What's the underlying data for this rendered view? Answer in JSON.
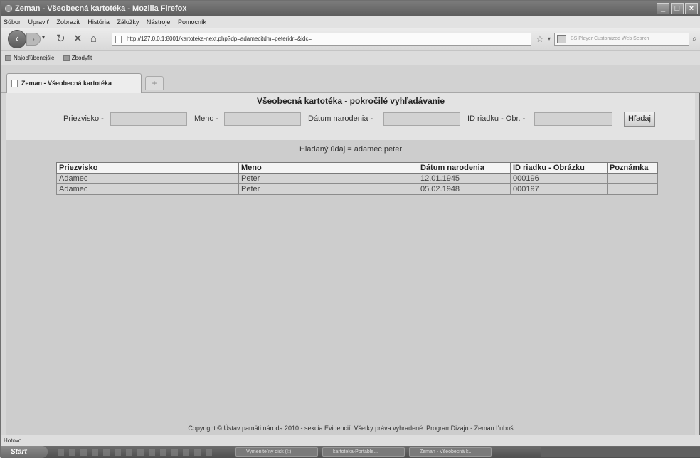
{
  "window": {
    "title": "Zeman - Všeobecná kartotéka - Mozilla Firefox"
  },
  "menu": [
    "Súbor",
    "Upraviť",
    "Zobraziť",
    "História",
    "Záložky",
    "Nástroje",
    "Pomocník"
  ],
  "nav": {
    "url": "http://127.0.0.1:8001/kartoteka-next.php?dp=adamecitdm=peteridr=&idc=",
    "search_placeholder": "BS Player Customized Web Search"
  },
  "bookmarks": [
    "Najobľúbenejšie",
    "Zbodyfit"
  ],
  "tab": {
    "label": "Zeman - Všeobecná kartotéka",
    "new": "+"
  },
  "page": {
    "title": "Všeobecná kartotéka - pokročilé vyhľadávanie",
    "form": {
      "surname_label": "Priezvisko -",
      "name_label": "Meno -",
      "dob_label": "Dátum narodenia -",
      "id_label": "ID riadku - Obr. -",
      "search_button": "Hľadaj"
    },
    "result_text": "Hladaný údaj = adamec peter",
    "table": {
      "headers": [
        "Priezvisko",
        "Meno",
        "Dátum narodenia",
        "ID riadku - Obrázku",
        "Poznámka"
      ],
      "rows": [
        [
          "Adamec",
          "Peter",
          "12.01.1945",
          "000196",
          ""
        ],
        [
          "Adamec",
          "Peter",
          "05.02.1948",
          "000197",
          ""
        ]
      ]
    },
    "footer": "Copyright © Ústav pamäti národa 2010 - sekcia Evidencií. Všetky práva vyhradené. ProgramDizajn - Zeman Ľuboš"
  },
  "status": "Hotovo",
  "taskbar": {
    "start": "Start",
    "tasks": [
      "Vymeniteľný disk (I:)",
      "kartoteka-Portable...",
      "Zeman - Všeobecná k..."
    ]
  }
}
